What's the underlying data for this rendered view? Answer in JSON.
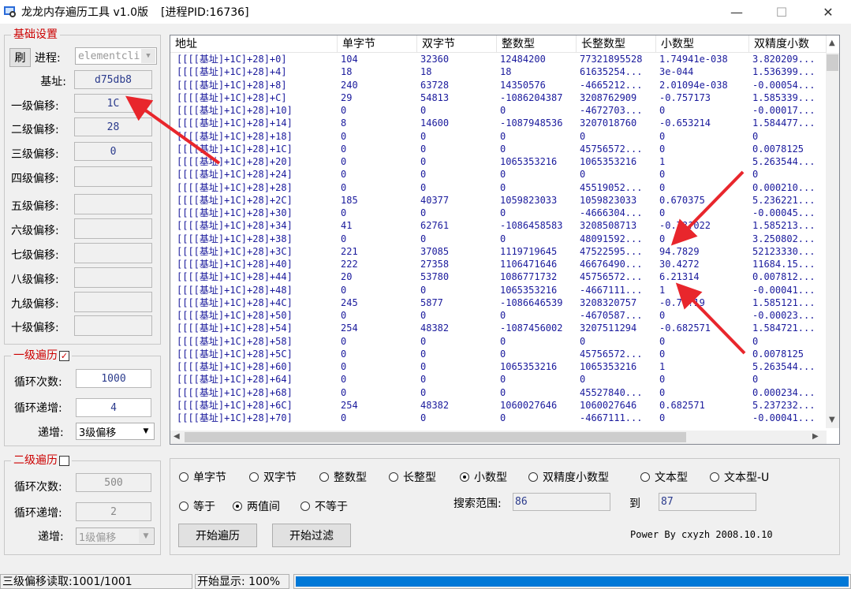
{
  "window": {
    "title": "龙龙内存遍历工具 v1.0版",
    "pid": "[进程PID:16736]",
    "minimize": "—",
    "maximize": "☐",
    "close": "✕"
  },
  "basic": {
    "group_title": "基础设置",
    "refresh_label": "刷",
    "process_label": "进程:",
    "process_value": "elementcli",
    "base_label": "基址:",
    "base_value": "d75db8",
    "offsets": [
      {
        "label": "一级偏移:",
        "value": "1C"
      },
      {
        "label": "二级偏移:",
        "value": "28"
      },
      {
        "label": "三级偏移:",
        "value": "0"
      },
      {
        "label": "四级偏移:",
        "value": ""
      },
      {
        "label": "五级偏移:",
        "value": ""
      },
      {
        "label": "六级偏移:",
        "value": ""
      },
      {
        "label": "七级偏移:",
        "value": ""
      },
      {
        "label": "八级偏移:",
        "value": ""
      },
      {
        "label": "九级偏移:",
        "value": ""
      },
      {
        "label": "十级偏移:",
        "value": ""
      }
    ]
  },
  "level1": {
    "title": "一级遍历",
    "checked": true,
    "loop_label": "循环次数:",
    "loop_value": "1000",
    "inc_label": "循环递增:",
    "inc_value": "4",
    "step_label": "递增:",
    "step_value": "3级偏移"
  },
  "level2": {
    "title": "二级遍历",
    "checked": false,
    "loop_label": "循环次数:",
    "loop_value": "500",
    "inc_label": "循环递增:",
    "inc_value": "2",
    "step_label": "递增:",
    "step_value": "1级偏移"
  },
  "table": {
    "columns": [
      "地址",
      "单字节",
      "双字节",
      "整数型",
      "长整数型",
      "小数型",
      "双精度小数"
    ],
    "rows": [
      [
        "[[[[基址]+1C]+28]+0]",
        "104",
        "32360",
        "12484200",
        "77321895528",
        "1.74941e-038",
        "3.820209..."
      ],
      [
        "[[[[基址]+1C]+28]+4]",
        "18",
        "18",
        "18",
        "61635254...",
        "3e-044",
        "1.536399..."
      ],
      [
        "[[[[基址]+1C]+28]+8]",
        "240",
        "63728",
        "14350576",
        "-4665212...",
        "2.01094e-038",
        "-0.00054..."
      ],
      [
        "[[[[基址]+1C]+28]+C]",
        "29",
        "54813",
        "-1086204387",
        "3208762909",
        "-0.757173",
        "1.585339..."
      ],
      [
        "[[[[基址]+1C]+28]+10]",
        "0",
        "0",
        "0",
        "-4672703...",
        "0",
        "-0.00017..."
      ],
      [
        "[[[[基址]+1C]+28]+14]",
        "8",
        "14600",
        "-1087948536",
        "3207018760",
        "-0.653214",
        "1.584477..."
      ],
      [
        "[[[[基址]+1C]+28]+18]",
        "0",
        "0",
        "0",
        "0",
        "0",
        "0"
      ],
      [
        "[[[[基址]+1C]+28]+1C]",
        "0",
        "0",
        "0",
        "45756572...",
        "0",
        "0.0078125"
      ],
      [
        "[[[[基址]+1C]+28]+20]",
        "0",
        "0",
        "1065353216",
        "1065353216",
        "1",
        "5.263544..."
      ],
      [
        "[[[[基址]+1C]+28]+24]",
        "0",
        "0",
        "0",
        "0",
        "0",
        "0"
      ],
      [
        "[[[[基址]+1C]+28]+28]",
        "0",
        "0",
        "0",
        "45519052...",
        "0",
        "0.000210..."
      ],
      [
        "[[[[基址]+1C]+28]+2C]",
        "185",
        "40377",
        "1059823033",
        "1059823033",
        "0.670375",
        "5.236221..."
      ],
      [
        "[[[[基址]+1C]+28]+30]",
        "0",
        "0",
        "0",
        "-4666304...",
        "0",
        "-0.00045..."
      ],
      [
        "[[[[基址]+1C]+28]+34]",
        "41",
        "62761",
        "-1086458583",
        "3208508713",
        "-0.7??022",
        "1.585213..."
      ],
      [
        "[[[[基址]+1C]+28]+38]",
        "0",
        "0",
        "0",
        "48091592...",
        "0",
        "3.250802..."
      ],
      [
        "[[[[基址]+1C]+28]+3C]",
        "221",
        "37085",
        "1119719645",
        "47522595...",
        "94.7829",
        "52123330..."
      ],
      [
        "[[[[基址]+1C]+28]+40]",
        "222",
        "27358",
        "1106471646",
        "46676490...",
        "30.4272",
        "11684.15..."
      ],
      [
        "[[[[基址]+1C]+28]+44]",
        "20",
        "53780",
        "1086771732",
        "45756572...",
        "6.21314",
        "0.007812..."
      ],
      [
        "[[[[基址]+1C]+28]+48]",
        "0",
        "0",
        "1065353216",
        "-4667111...",
        "1",
        "-0.00041..."
      ],
      [
        "[[[[基址]+1C]+28]+4C]",
        "245",
        "5877",
        "-1086646539",
        "3208320757",
        "-0.7??19",
        "1.585121..."
      ],
      [
        "[[[[基址]+1C]+28]+50]",
        "0",
        "0",
        "0",
        "-4670587...",
        "0",
        "-0.00023..."
      ],
      [
        "[[[[基址]+1C]+28]+54]",
        "254",
        "48382",
        "-1087456002",
        "3207511294",
        "-0.682571",
        "1.584721..."
      ],
      [
        "[[[[基址]+1C]+28]+58]",
        "0",
        "0",
        "0",
        "0",
        "0",
        "0"
      ],
      [
        "[[[[基址]+1C]+28]+5C]",
        "0",
        "0",
        "0",
        "45756572...",
        "0",
        "0.0078125"
      ],
      [
        "[[[[基址]+1C]+28]+60]",
        "0",
        "0",
        "1065353216",
        "1065353216",
        "1",
        "5.263544..."
      ],
      [
        "[[[[基址]+1C]+28]+64]",
        "0",
        "0",
        "0",
        "0",
        "0",
        "0"
      ],
      [
        "[[[[基址]+1C]+28]+68]",
        "0",
        "0",
        "0",
        "45527840...",
        "0",
        "0.000234..."
      ],
      [
        "[[[[基址]+1C]+28]+6C]",
        "254",
        "48382",
        "1060027646",
        "1060027646",
        "0.682571",
        "5.237232..."
      ],
      [
        "[[[[基址]+1C]+28]+70]",
        "0",
        "0",
        "0",
        "-4667111...",
        "0",
        "-0.00041..."
      ]
    ]
  },
  "types": [
    {
      "label": "单字节",
      "selected": false
    },
    {
      "label": "双字节",
      "selected": false
    },
    {
      "label": "整数型",
      "selected": false
    },
    {
      "label": "长整型",
      "selected": false
    },
    {
      "label": "小数型",
      "selected": true
    },
    {
      "label": "双精度小数型",
      "selected": false
    },
    {
      "label": "文本型",
      "selected": false
    },
    {
      "label": "文本型-U",
      "selected": false
    }
  ],
  "compare": [
    {
      "label": "等于",
      "selected": false
    },
    {
      "label": "两值间",
      "selected": true
    },
    {
      "label": "不等于",
      "selected": false
    }
  ],
  "search": {
    "range_label": "搜索范围:",
    "from": "86",
    "to_label": "到",
    "to": "87"
  },
  "actions": {
    "start_traverse": "开始遍历",
    "start_filter": "开始过滤",
    "credit": "Power By cxyzh 2008.10.10"
  },
  "status": {
    "read": "三级偏移读取:1001/1001",
    "display": "开始显示: 100%",
    "progress": 1.0
  },
  "colors": {
    "accent_red": "#cc0000",
    "value_blue": "#1a1a9c",
    "progress_blue": "#0078d7",
    "arrow_red": "#e8262c"
  }
}
